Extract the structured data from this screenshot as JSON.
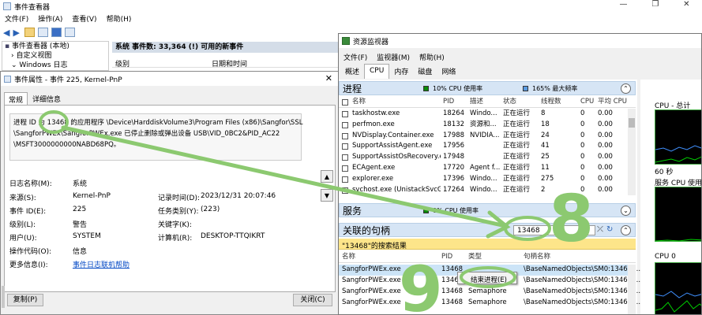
{
  "event_viewer": {
    "title": "事件查看器",
    "menu": [
      "文件(F)",
      "操作(A)",
      "查看(V)",
      "帮助(H)"
    ],
    "tree": [
      "事件查看器 (本地)",
      "自定义视图",
      "Windows 日志"
    ],
    "list_header": "系统   事件数: 33,364 (!) 可用的新事件",
    "col_level": "级别",
    "col_date": "日期和时间"
  },
  "event_props": {
    "title": "事件属性 - 事件 225, Kernel-PnP",
    "tabs": [
      "常规",
      "详细信息"
    ],
    "description_lines": [
      "进程 ID 为 13468 的应用程序 \\Device\\HarddiskVolume3\\Program Files (x86)\\Sangfor\\SSL",
      "\\SangforPWEx\\SangforPWEx.exe 已停止删除或弹出设备 USB\\VID_0BC2&PID_AC22",
      "\\MSFT3000000000NABD68PQ。"
    ],
    "fields_left": [
      {
        "label": "日志名称(M):",
        "value": "系统"
      },
      {
        "label": "来源(S):",
        "value": "Kernel-PnP"
      },
      {
        "label": "事件 ID(E):",
        "value": "225"
      },
      {
        "label": "级别(L):",
        "value": "警告"
      },
      {
        "label": "用户(U):",
        "value": "SYSTEM"
      },
      {
        "label": "操作代码(O):",
        "value": "信息"
      },
      {
        "label": "更多信息(I):",
        "value": "事件日志联机帮助"
      }
    ],
    "fields_right": [
      {
        "label": "记录时间(D):",
        "value": "2023/12/31 20:07:46"
      },
      {
        "label": "任务类别(Y):",
        "value": "(223)"
      },
      {
        "label": "关键字(K):",
        "value": ""
      },
      {
        "label": "计算机(R):",
        "value": "DESKTOP-TTQIKRT"
      }
    ],
    "copy_button": "复制(P)",
    "close_button": "关闭(C)"
  },
  "resmon": {
    "title": "资源监视器",
    "menu": [
      "文件(F)",
      "监视器(M)",
      "帮助(H)"
    ],
    "tabs": [
      "概述",
      "CPU",
      "内存",
      "磁盘",
      "网络"
    ],
    "process_section": {
      "title": "进程",
      "cpu_usage": "10% CPU 使用率",
      "max_freq": "165% 最大频率",
      "columns": [
        "名称",
        "PID",
        "描述",
        "状态",
        "线程数",
        "CPU",
        "平均 CPU"
      ],
      "rows": [
        [
          "taskhostw.exe",
          "18264",
          "Windo...",
          "正在运行",
          "8",
          "0",
          "0.00"
        ],
        [
          "perfmon.exe",
          "18132",
          "资源和...",
          "正在运行",
          "18",
          "0",
          "0.00"
        ],
        [
          "NVDisplay.Container.exe",
          "17988",
          "NVIDIA...",
          "正在运行",
          "24",
          "0",
          "0.00"
        ],
        [
          "SupportAssistAgent.exe",
          "17956",
          "",
          "正在运行",
          "41",
          "0",
          "0.00"
        ],
        [
          "SupportAssistOsRecovery.exe",
          "17948",
          "",
          "正在运行",
          "25",
          "0",
          "0.00"
        ],
        [
          "ECAgent.exe",
          "17720",
          "Agent f...",
          "正在运行",
          "11",
          "0",
          "0.00"
        ],
        [
          "explorer.exe",
          "17396",
          "Windo...",
          "正在运行",
          "275",
          "0",
          "0.00"
        ],
        [
          "svchost.exe (UnistackSvcGro...",
          "17264",
          "Windo...",
          "正在运行",
          "2",
          "0",
          "0.00"
        ]
      ]
    },
    "services_section": {
      "title": "服务",
      "cpu_usage": "0% CPU 使用率"
    },
    "handles_section": {
      "title": "关联的句柄",
      "search_value": "13468",
      "result_banner": "\"13468\"的搜索结果",
      "columns": [
        "名称",
        "PID",
        "类型",
        "句柄名称"
      ],
      "rows": [
        [
          "SangforPWEx.exe",
          "13468",
          "",
          "\\BaseNamedObjects\\SM0:13468:..."
        ],
        [
          "SangforPWEx.exe",
          "13468",
          "",
          "\\BaseNamedObjects\\SM0:13468:..."
        ],
        [
          "SangforPWEx.exe",
          "13468",
          "Semaphore",
          "\\BaseNamedObjects\\SM0:13468:..."
        ],
        [
          "SangforPWEx.exe",
          "13468",
          "Semaphore",
          "\\BaseNamedObjects\\SM0:13468:..."
        ]
      ],
      "context_menu_item": "结束进程(E)"
    },
    "graphs": {
      "cpu_total": "CPU - 总计",
      "sixty_sec": "60 秒",
      "service_cpu": "服务 CPU 使用率",
      "cpu0": "CPU 0"
    }
  },
  "annotations": {
    "number_eight": "8",
    "number_nine": "9",
    "arrow_color": "#8cc970"
  }
}
